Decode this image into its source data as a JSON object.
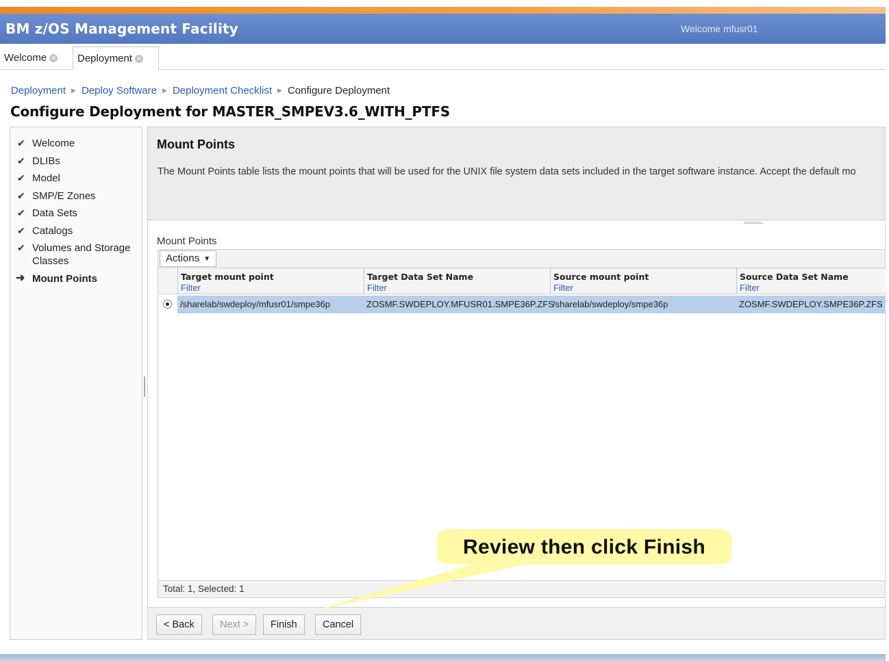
{
  "app": {
    "title": "BM z/OS Management Facility",
    "welcome": "Welcome mfusr01"
  },
  "tabs": [
    {
      "label": "Welcome"
    },
    {
      "label": "Deployment"
    }
  ],
  "breadcrumb": {
    "items": [
      "Deployment",
      "Deploy Software",
      "Deployment Checklist"
    ],
    "current": "Configure Deployment"
  },
  "page_title": "Configure Deployment for MASTER_SMPEV3.6_WITH_PTFS",
  "nav": {
    "items": [
      {
        "label": "Welcome"
      },
      {
        "label": "DLIBs"
      },
      {
        "label": "Model"
      },
      {
        "label": "SMP/E Zones"
      },
      {
        "label": "Data Sets"
      },
      {
        "label": "Catalogs"
      },
      {
        "label": "Volumes and Storage Classes"
      },
      {
        "label": "Mount Points"
      }
    ]
  },
  "section": {
    "title": "Mount Points",
    "description": "The Mount Points table lists the mount points that will be used for the UNIX file system data sets included in the target software instance.  Accept the default mo"
  },
  "table": {
    "caption": "Mount Points",
    "actions_label": "Actions",
    "filter_label": "Filter",
    "columns": [
      "Target mount point",
      "Target Data Set Name",
      "Source mount point",
      "Source Data Set Name"
    ],
    "rows": [
      [
        "/sharelab/swdeploy/mfusr01/smpe36p",
        "ZOSMF.SWDEPLOY.MFUSR01.SMPE36P.ZFS",
        "/sharelab/swdeploy/smpe36p",
        "ZOSMF.SWDEPLOY.SMPE36P.ZFS"
      ]
    ],
    "footer": "Total: 1, Selected: 1"
  },
  "buttons": {
    "back": "< Back",
    "next": "Next >",
    "finish": "Finish",
    "cancel": "Cancel"
  },
  "callout": "Review then click Finish",
  "colors": {
    "header": "#5478bf",
    "accent_orange": "#f08a24",
    "selected_row": "#b9cfea",
    "link": "#2a5db0",
    "callout": "#fff9a8"
  }
}
